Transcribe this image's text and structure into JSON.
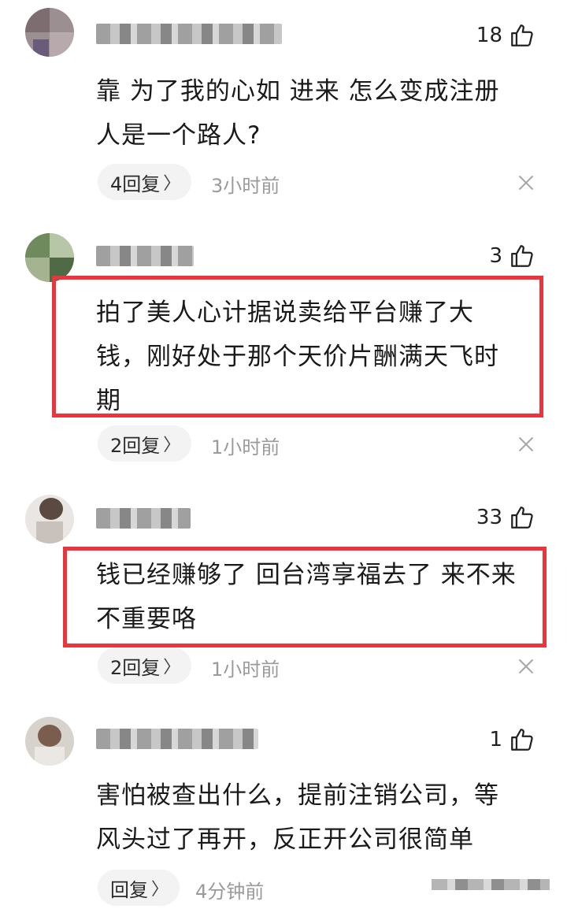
{
  "comments": [
    {
      "likes": "18",
      "lines": [
        "靠 为了我的心如 进来 怎么变成注册",
        "人是一个路人?"
      ],
      "reply_label": "4回复",
      "time": "3小时前"
    },
    {
      "likes": "3",
      "lines": [
        "拍了美人心计据说卖给平台赚了大",
        "钱，刚好处于那个天价片酬满天飞时",
        "期"
      ],
      "reply_label": "2回复",
      "time": "1小时前"
    },
    {
      "likes": "33",
      "lines": [
        "钱已经赚够了 回台湾享福去了 来不来",
        "不重要咯"
      ],
      "reply_label": "2回复",
      "time": "1小时前"
    },
    {
      "likes": "1",
      "lines": [
        "害怕被查出什么，提前注销公司，等",
        "风头过了再开，反正开公司很简单"
      ],
      "reply_label": "回复",
      "time": "4分钟前"
    }
  ],
  "icons": {
    "like": "thumbs-up-icon",
    "close": "close-icon",
    "reply_chevron": "chevron-right-icon"
  },
  "colors": {
    "highlight": "#e8363c",
    "secondary_text": "#9a9a9a",
    "reply_bg": "#f3f3f3"
  }
}
